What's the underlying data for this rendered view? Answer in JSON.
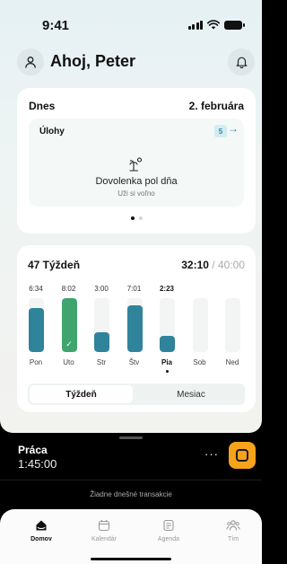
{
  "status": {
    "time": "9:41"
  },
  "header": {
    "greeting": "Ahoj, Peter"
  },
  "today": {
    "title": "Dnes",
    "date": "2. februára",
    "tasks_label": "Úlohy",
    "tasks_count": "5",
    "vacation_title": "Dovolenka pol dňa",
    "vacation_subtitle": "Uži si voľno",
    "page_indicator": {
      "count": 2,
      "active": 0
    }
  },
  "week": {
    "title": "47 Týždeň",
    "hours_done": "32:10",
    "hours_target": "40:00",
    "days": [
      {
        "label": "Pon",
        "value": "6:34",
        "fraction": 0.82,
        "color": "#2f839b"
      },
      {
        "label": "Uto",
        "value": "8:02",
        "fraction": 1.0,
        "color": "#3fa46e",
        "done": true
      },
      {
        "label": "Str",
        "value": "3:00",
        "fraction": 0.37,
        "color": "#2f839b"
      },
      {
        "label": "Štv",
        "value": "7:01",
        "fraction": 0.87,
        "color": "#2f839b"
      },
      {
        "label": "Pia",
        "value": "2:23",
        "fraction": 0.3,
        "color": "#2f839b",
        "current": true
      },
      {
        "label": "Sob",
        "value": "",
        "fraction": 0
      },
      {
        "label": "Ned",
        "value": "",
        "fraction": 0
      }
    ],
    "segment": {
      "active": "Týždeň",
      "inactive": "Mesiac"
    }
  },
  "tracker": {
    "label": "Práca",
    "time": "1:45:00",
    "more": "···",
    "accent": "#f7a21b"
  },
  "transactions": {
    "empty_text": "Žiadne dnešné transakcie"
  },
  "tabs": [
    {
      "label": "Domov",
      "icon": "home-icon",
      "active": true
    },
    {
      "label": "Kalendár",
      "icon": "calendar-icon"
    },
    {
      "label": "Agenda",
      "icon": "agenda-icon"
    },
    {
      "label": "Tím",
      "icon": "team-icon"
    }
  ]
}
